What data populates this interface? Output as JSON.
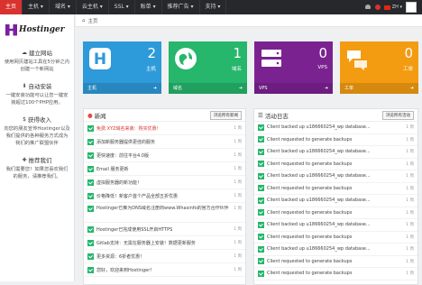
{
  "topbar": {
    "nav": [
      {
        "label": "主页",
        "active": true
      },
      {
        "label": "主机 ▾"
      },
      {
        "label": "域名 ▾"
      },
      {
        "label": "云主机 ▾"
      },
      {
        "label": "SSL ▾"
      },
      {
        "label": "账单 ▾"
      },
      {
        "label": "推荐广告 ▾"
      },
      {
        "label": "支持 ▾"
      }
    ],
    "lang": "ZH ▾"
  },
  "sidebar": {
    "logo": "Hostinger",
    "blocks": [
      {
        "icon": "☁",
        "title": "建立网站",
        "text": "使用网页建站工具在5分钟之内创建一个新网站"
      },
      {
        "icon": "⬇",
        "title": "自动安装",
        "text": "一键安装功能可以让您一键安装超过100个PHP应用。"
      },
      {
        "icon": "$",
        "title": "获得收入",
        "text": "向您的朋友宣传Hostinger以及我们提供的各种服务方式成为我们的推广联盟伙伴"
      },
      {
        "icon": "✚",
        "title": "推荐我们",
        "text": "我们需要您！如果您喜欢我们的服务，请推荐我们。"
      }
    ]
  },
  "breadcrumb": "主页",
  "cards": [
    {
      "icon": "H",
      "num": "2",
      "label": "主机",
      "footer": "主机"
    },
    {
      "icon": "globe",
      "num": "1",
      "label": "域名",
      "footer": "域名"
    },
    {
      "icon": "server",
      "num": "0",
      "label": "VPS",
      "footer": "VPS"
    },
    {
      "icon": "chat",
      "num": "0",
      "label": "工单",
      "footer": "工单"
    }
  ],
  "news": {
    "title": "新闻",
    "more": "浏览所有新闻",
    "items": [
      {
        "text": "免费.XYZ域名来袭：购买优惠！",
        "date": "1 周",
        "red": true
      },
      {
        "text": "添加新服务器提供更佳的服务",
        "date": "1 周"
      },
      {
        "text": "更快速度：前往平台4.0版",
        "date": "1 周"
      },
      {
        "text": "Email 服务更新",
        "date": "1 周"
      },
      {
        "text": "虚拟服务器的新功能！",
        "date": "1 周"
      },
      {
        "text": "价格降低！新客户首个产品全部五折优惠",
        "date": "1 周"
      },
      {
        "text": "Hostinger已推为DNS域名注册商www.Whasinfo的官方合作伙伴",
        "date": "1 周",
        "tall": true
      },
      {
        "text": "Hostinger已完成使用SSL开启HTTPS",
        "date": "1 周"
      },
      {
        "text": "Gitlab支持：无需在服务器上安装！数据更新服务",
        "date": "1 周"
      },
      {
        "text": "更多资源：6折者优惠！",
        "date": "1 周"
      },
      {
        "text": "您好，欢迎来到Hostinger!",
        "date": "1 周"
      }
    ]
  },
  "log": {
    "title": "活动日志",
    "more": "浏览所有活动",
    "items": [
      {
        "text": "Client backed up u186660254_wp database...",
        "date": "1 周"
      },
      {
        "text": "Client requested to generate backups",
        "date": "1 周"
      },
      {
        "text": "Client backed up u186660254_wp database...",
        "date": "1 周"
      },
      {
        "text": "Client requested to generate backups",
        "date": "1 周"
      },
      {
        "text": "Client backed up u186660254_wp database...",
        "date": "1 周"
      },
      {
        "text": "Client requested to generate backups",
        "date": "1 周"
      },
      {
        "text": "Client backed up u186660254_wp database...",
        "date": "1 周"
      },
      {
        "text": "Client requested to generate backups",
        "date": "1 周"
      },
      {
        "text": "Client backed up u186660254_wp database...",
        "date": "1 周"
      },
      {
        "text": "Client requested to generate backups",
        "date": "1 周"
      },
      {
        "text": "Client backed up u186660254_wp database...",
        "date": "1 周"
      },
      {
        "text": "Client requested to generate backups",
        "date": "1 周"
      },
      {
        "text": "Client requested to generate backups",
        "date": "1 周"
      }
    ]
  }
}
